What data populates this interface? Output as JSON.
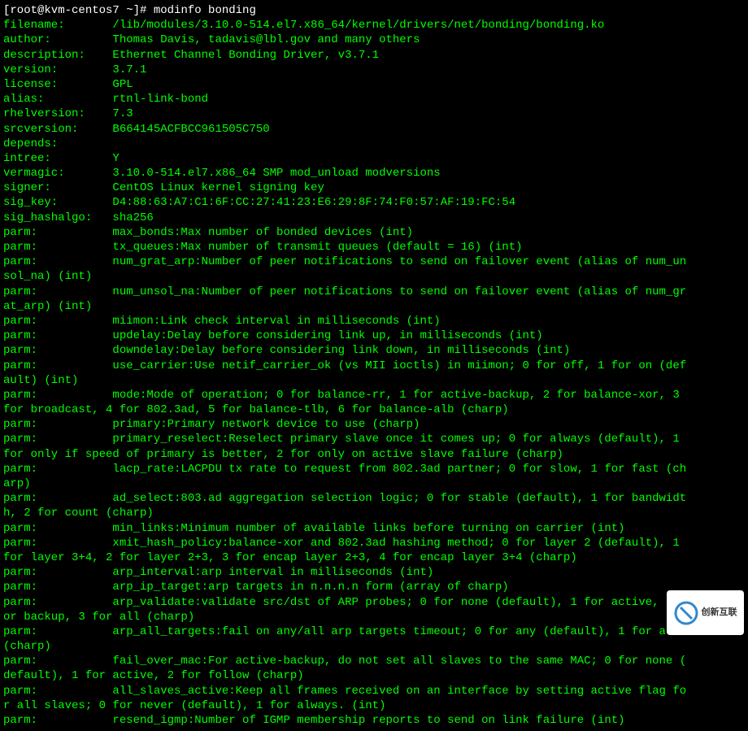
{
  "prompt": "[root@kvm-centos7 ~]# ",
  "command": "modinfo bonding",
  "fields": [
    {
      "k": "filename:",
      "v": "/lib/modules/3.10.0-514.el7.x86_64/kernel/drivers/net/bonding/bonding.ko"
    },
    {
      "k": "author:",
      "v": "Thomas Davis, tadavis@lbl.gov and many others"
    },
    {
      "k": "description:",
      "v": "Ethernet Channel Bonding Driver, v3.7.1"
    },
    {
      "k": "version:",
      "v": "3.7.1"
    },
    {
      "k": "license:",
      "v": "GPL"
    },
    {
      "k": "alias:",
      "v": "rtnl-link-bond"
    },
    {
      "k": "rhelversion:",
      "v": "7.3"
    },
    {
      "k": "srcversion:",
      "v": "B664145ACFBCC961505C750"
    },
    {
      "k": "depends:",
      "v": ""
    },
    {
      "k": "intree:",
      "v": "Y"
    },
    {
      "k": "vermagic:",
      "v": "3.10.0-514.el7.x86_64 SMP mod_unload modversions"
    },
    {
      "k": "signer:",
      "v": "CentOS Linux kernel signing key"
    },
    {
      "k": "sig_key:",
      "v": "D4:88:63:A7:C1:6F:CC:27:41:23:E6:29:8F:74:F0:57:AF:19:FC:54"
    },
    {
      "k": "sig_hashalgo:",
      "v": "sha256"
    }
  ],
  "parms": [
    "max_bonds:Max number of bonded devices (int)",
    "tx_queues:Max number of transmit queues (default = 16) (int)",
    "num_grat_arp:Number of peer notifications to send on failover event (alias of num_unsol_na) (int)",
    "num_unsol_na:Number of peer notifications to send on failover event (alias of num_grat_arp) (int)",
    "miimon:Link check interval in milliseconds (int)",
    "updelay:Delay before considering link up, in milliseconds (int)",
    "downdelay:Delay before considering link down, in milliseconds (int)",
    "use_carrier:Use netif_carrier_ok (vs MII ioctls) in miimon; 0 for off, 1 for on (default) (int)",
    "mode:Mode of operation; 0 for balance-rr, 1 for active-backup, 2 for balance-xor, 3 for broadcast, 4 for 802.3ad, 5 for balance-tlb, 6 for balance-alb (charp)",
    "primary:Primary network device to use (charp)",
    "primary_reselect:Reselect primary slave once it comes up; 0 for always (default), 1 for only if speed of primary is better, 2 for only on active slave failure (charp)",
    "lacp_rate:LACPDU tx rate to request from 802.3ad partner; 0 for slow, 1 for fast (charp)",
    "ad_select:803.ad aggregation selection logic; 0 for stable (default), 1 for bandwidth, 2 for count (charp)",
    "min_links:Minimum number of available links before turning on carrier (int)",
    "xmit_hash_policy:balance-xor and 802.3ad hashing method; 0 for layer 2 (default), 1 for layer 3+4, 2 for layer 2+3, 3 for encap layer 2+3, 4 for encap layer 3+4 (charp)",
    "arp_interval:arp interval in milliseconds (int)",
    "arp_ip_target:arp targets in n.n.n.n form (array of charp)",
    "arp_validate:validate src/dst of ARP probes; 0 for none (default), 1 for active, 2 for backup, 3 for all (charp)",
    "arp_all_targets:fail on any/all arp targets timeout; 0 for any (default), 1 for all (charp)",
    "fail_over_mac:For active-backup, do not set all slaves to the same MAC; 0 for none (default), 1 for active, 2 for follow (charp)",
    "all_slaves_active:Keep all frames received on an interface by setting active flag for all slaves; 0 for never (default), 1 for always. (int)",
    "resend_igmp:Number of IGMP membership reports to send on link failure (int)"
  ],
  "parm_label": "parm:",
  "parm_overflow_label": " ",
  "watermark": "创新互联"
}
